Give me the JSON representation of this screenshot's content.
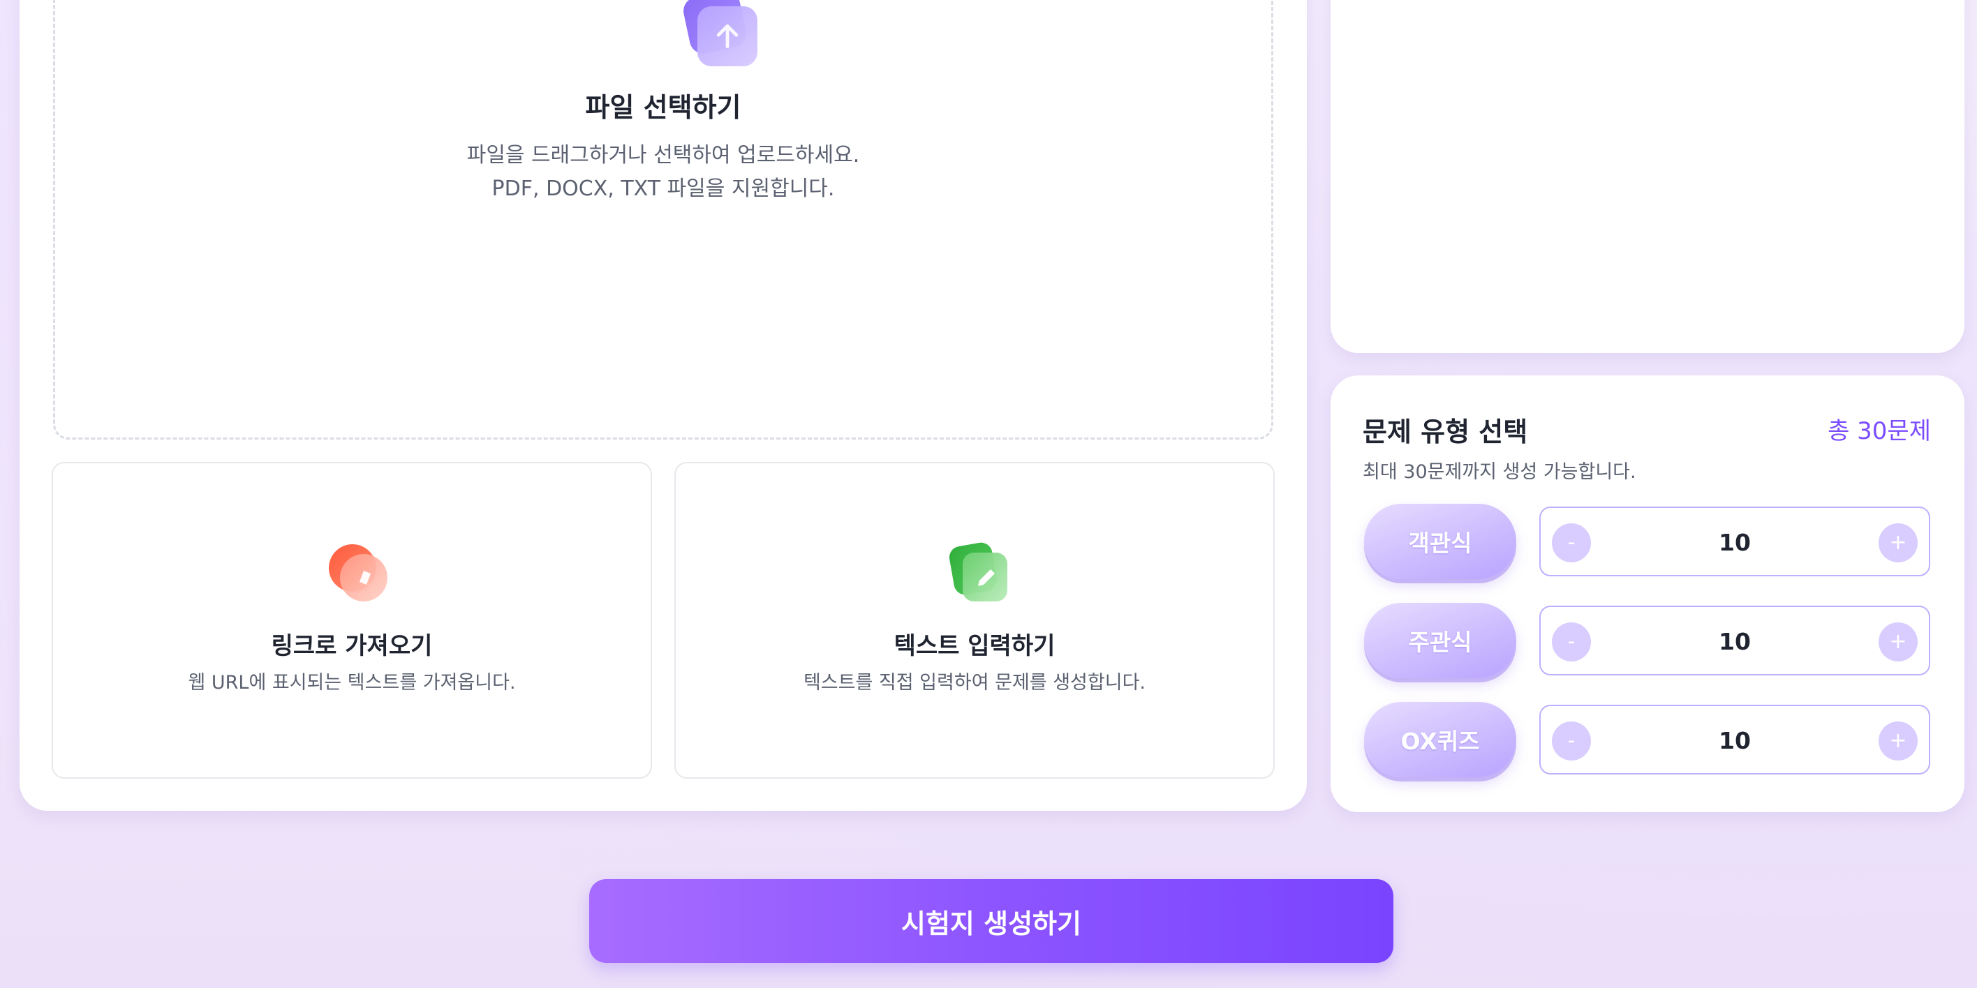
{
  "upload": {
    "title": "파일 선택하기",
    "description_line1": "파일을 드래그하거나 선택하여 업로드하세요.",
    "description_line2": "PDF, DOCX, TXT 파일을 지원합니다.",
    "icon": "upload-arrow-icon"
  },
  "options": [
    {
      "title": "링크로 가져오기",
      "description": "웹 URL에 표시되는 텍스트를 가져옵니다.",
      "icon": "link-icon"
    },
    {
      "title": "텍스트 입력하기",
      "description": "텍스트를 직접 입력하여 문제를 생성합니다.",
      "icon": "pencil-icon"
    }
  ],
  "question_types": {
    "title": "문제 유형 선택",
    "total": "총 30문제",
    "subtitle": "최대 30문제까지 생성 가능합니다.",
    "rows": [
      {
        "label": "객관식",
        "value": "10",
        "minus": "-",
        "plus": "+"
      },
      {
        "label": "주관식",
        "value": "10",
        "minus": "-",
        "plus": "+"
      },
      {
        "label": "OX퀴즈",
        "value": "10",
        "minus": "-",
        "plus": "+"
      }
    ]
  },
  "actions": {
    "generate_label": "시험지 생성하기"
  },
  "colors": {
    "accent": "#7b4dff",
    "pill": "#cdbdff",
    "stepper_border": "#bfb0ff",
    "link_icon": "#ff6a4d",
    "text_icon": "#3cbf4a"
  }
}
